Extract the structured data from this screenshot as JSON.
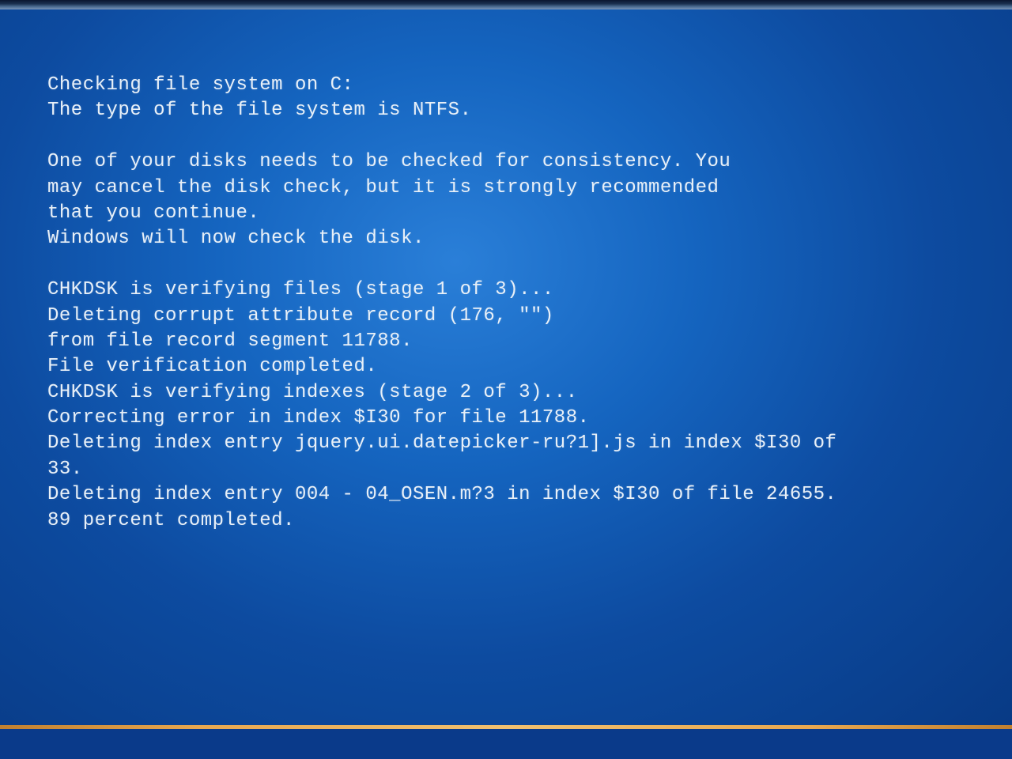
{
  "chkdsk": {
    "header1": "Checking file system on C:",
    "header2": "The type of the file system is NTFS.",
    "msg1": "One of your disks needs to be checked for consistency. You",
    "msg2": "may cancel the disk check, but it is strongly recommended",
    "msg3": "that you continue.",
    "msg4": "Windows will now check the disk.",
    "stage1": "CHKDSK is verifying files (stage 1 of 3)...",
    "del_attr": "Deleting corrupt attribute record (176, \"\")",
    "from_seg": "from file record segment 11788.",
    "verif_done": "File verification completed.",
    "stage2": "CHKDSK is verifying indexes (stage 2 of 3)...",
    "corr_idx": "Correcting error in index $I30 for file 11788.",
    "del_idx1": "Deleting index entry jquery.ui.datepicker-ru?1].js in index $I30 of ",
    "del_idx1b": "33.",
    "del_idx2": "Deleting index entry 004 - 04_OSEN.m?3 in index $I30 of file 24655.",
    "percent": "89 percent completed."
  }
}
